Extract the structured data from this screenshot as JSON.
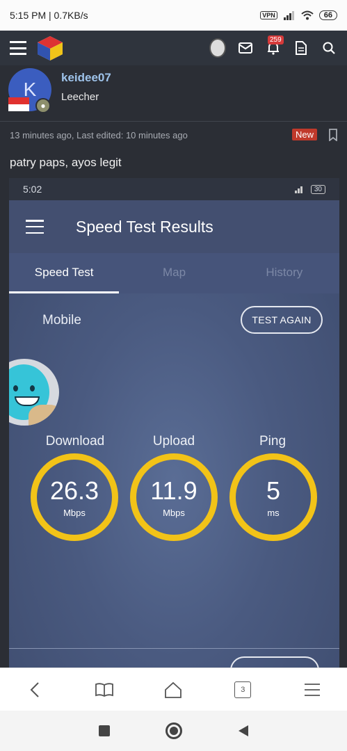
{
  "status_bar": {
    "time_speed": "5:15 PM | 0.7KB/s",
    "vpn": "VPN",
    "battery": "66"
  },
  "forum_header": {
    "notif_count": "259"
  },
  "post": {
    "avatar_letter": "K",
    "username": "keidee07",
    "user_title": "Leecher",
    "meta": "13 minutes ago, Last edited: 10 minutes ago",
    "new_badge": "New",
    "body": "patry paps, ayos legit"
  },
  "embed": {
    "status_time": "5:02",
    "battery": "30",
    "title": "Speed Test Results",
    "tabs": [
      "Speed Test",
      "Map",
      "History"
    ],
    "connection": "Mobile",
    "test_again": "TEST AGAIN",
    "metrics": [
      {
        "label": "Download",
        "value": "26.3",
        "unit": "Mbps"
      },
      {
        "label": "Upload",
        "value": "11.9",
        "unit": "Mbps"
      },
      {
        "label": "Ping",
        "value": "5",
        "unit": "ms"
      }
    ]
  },
  "browser_nav": {
    "tab_count": "3"
  },
  "colors": {
    "ring": "#f2c318",
    "username": "#9ec3ea",
    "new_badge": "#c0392b"
  }
}
